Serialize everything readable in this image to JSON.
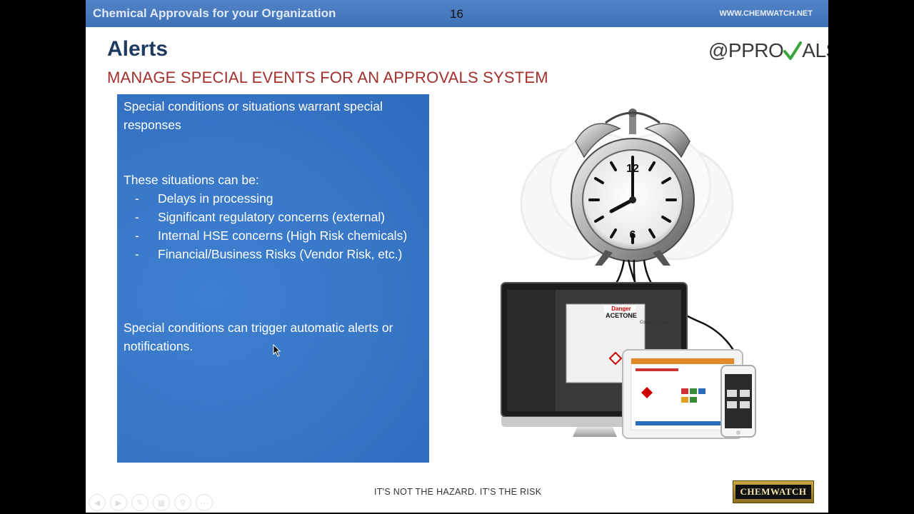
{
  "header": {
    "title": "Chemical Approvals for your Organization",
    "slide_number": "16",
    "website": "WWW.CHEMWATCH.NET"
  },
  "slide": {
    "heading": "Alerts",
    "subheading": "MANAGE SPECIAL EVENTS FOR AN APPROVALS SYSTEM",
    "logo_text_1": "@PPRO",
    "logo_text_2": "ALS",
    "content": {
      "intro": "Special conditions or situations warrant special responses",
      "list_heading": "These situations can be:",
      "items": [
        "Delays in processing",
        "Significant regulatory concerns (external)",
        "Internal HSE concerns (High Risk chemicals)",
        "Financial/Business Risks (Vendor Risk, etc.)"
      ],
      "bullet": "-",
      "conclusion": "Special conditions can trigger automatic alerts or notifications."
    },
    "illustration": {
      "clock_12": "12",
      "clock_6": "6",
      "screen_label_danger": "Danger",
      "screen_label_chemical": "ACETONE",
      "screen_label_contact": "Contact Details"
    }
  },
  "footer": {
    "tagline": "IT'S NOT THE HAZARD. IT'S THE RISK",
    "brand": "CHEMWATCH"
  },
  "nav_buttons": [
    "prev-icon",
    "next-icon",
    "pen-icon",
    "slides-icon",
    "zoom-icon",
    "more-icon"
  ],
  "colors": {
    "header_bar": "#4a7bc0",
    "heading": "#1f3a5f",
    "subheading": "#a3302c",
    "content_box": "#3a78c8",
    "check_green": "#3aa53a"
  }
}
